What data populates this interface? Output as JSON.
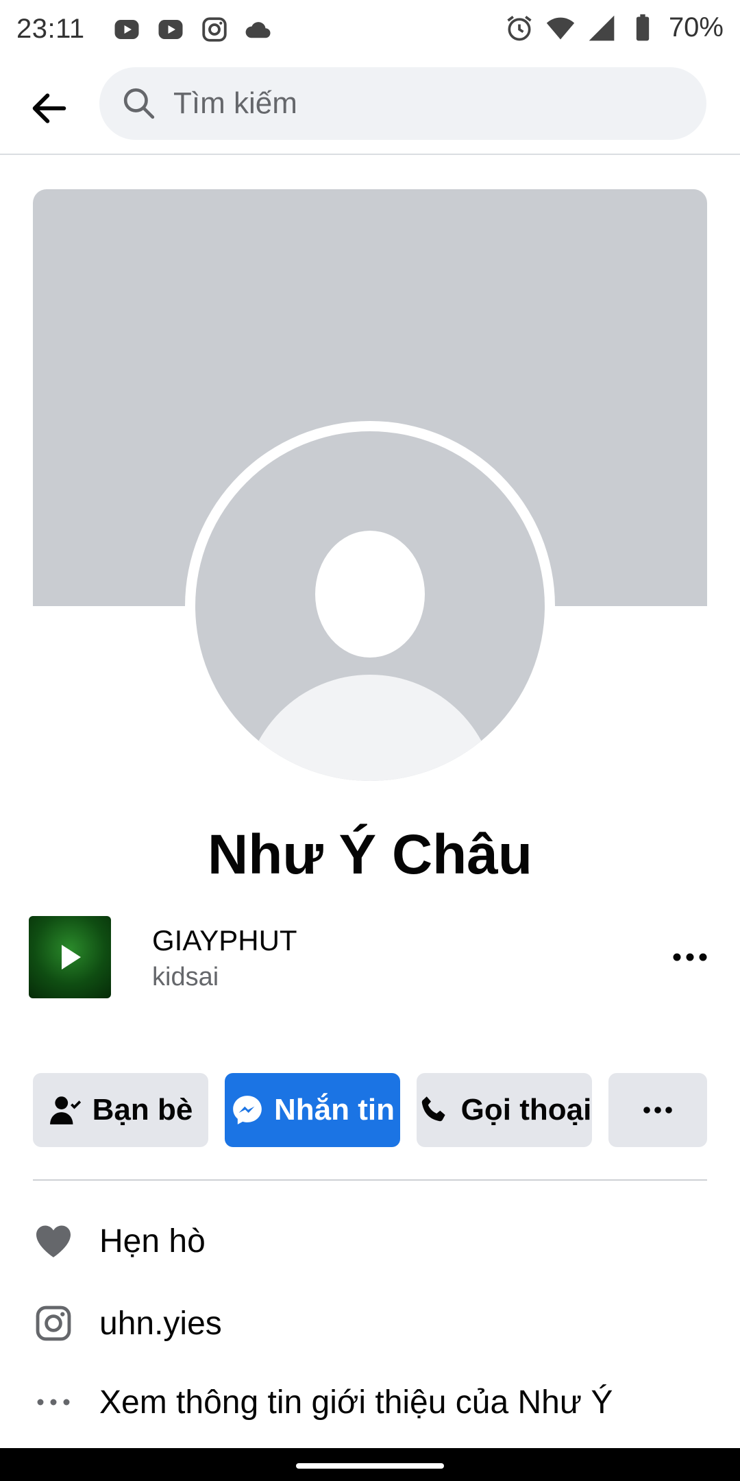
{
  "status_bar": {
    "time": "23:11",
    "battery_percent": "70%",
    "app_icons": [
      "youtube-icon",
      "youtube-icon",
      "instagram-icon",
      "cloud-icon"
    ],
    "system_icons": [
      "alarm-icon",
      "wifi-icon",
      "signal-icon",
      "battery-icon"
    ]
  },
  "header": {
    "search_placeholder": "Tìm kiếm"
  },
  "profile": {
    "name": "Như Ý Châu"
  },
  "music": {
    "title": "GIAYPHUT",
    "artist": "kidsai"
  },
  "actions": {
    "friends_label": "Bạn bè",
    "message_label": "Nhắn tin",
    "call_label": "Gọi thoại"
  },
  "info": {
    "dating_label": "Hẹn hò",
    "instagram_label": "uhn.yies",
    "about_label": "Xem thông tin giới thiệu của Như Ý"
  },
  "colors": {
    "primary_blue": "#1b74e4",
    "button_gray": "#e4e6eb",
    "placeholder_gray": "#c9ccd1"
  }
}
